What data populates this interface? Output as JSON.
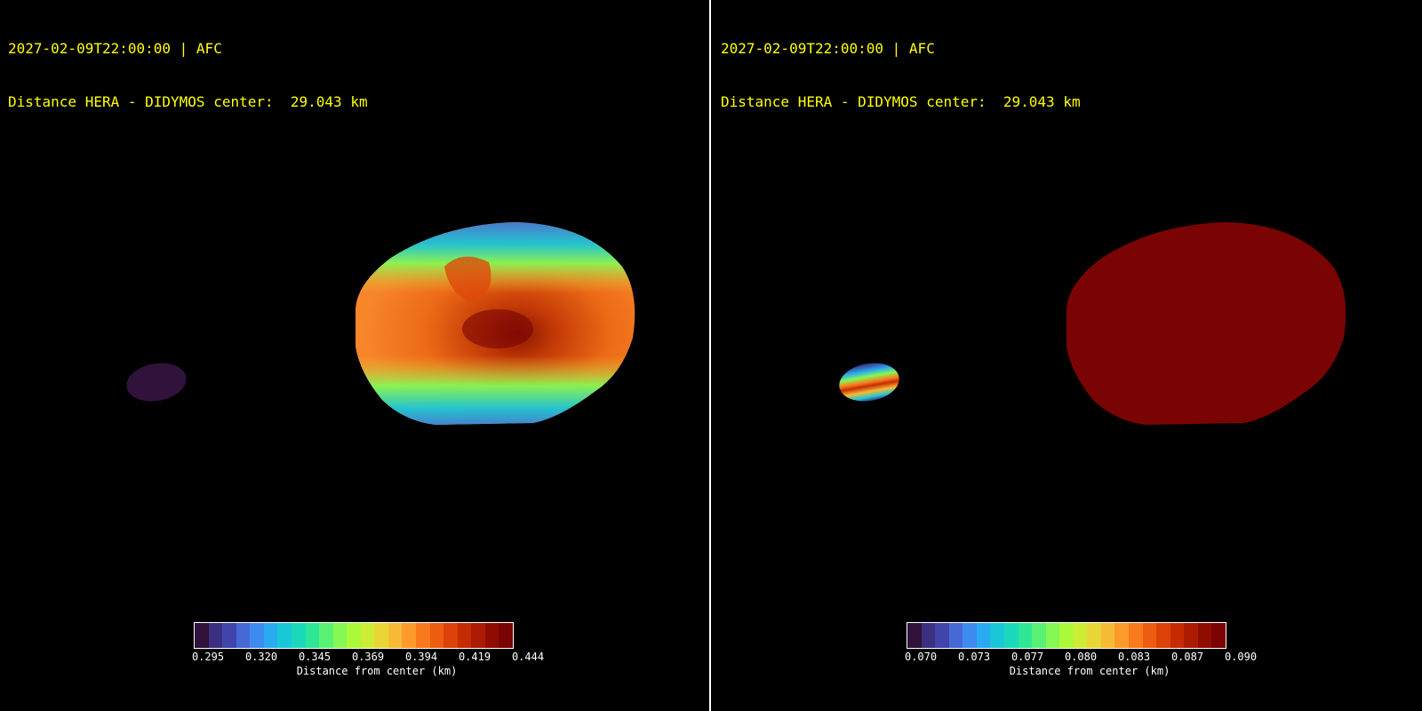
{
  "left_panel": {
    "header_line1": "2027-02-09T22:00:00 | AFC",
    "header_line2": "Distance HERA - DIDYMOS center:  29.043 km",
    "colorbar": {
      "ticks": [
        "0.295",
        "0.320",
        "0.345",
        "0.369",
        "0.394",
        "0.419",
        "0.444"
      ],
      "label": "Distance from center (km)"
    }
  },
  "right_panel": {
    "header_line1": "2027-02-09T22:00:00 | AFC",
    "header_line2": "Distance HERA - DIDYMOS center:  29.043 km",
    "colorbar": {
      "ticks": [
        "0.070",
        "0.073",
        "0.077",
        "0.080",
        "0.083",
        "0.087",
        "0.090"
      ],
      "label": "Distance from center (km)"
    }
  },
  "colormap": [
    "#30123b",
    "#3b2f80",
    "#4145ab",
    "#4669d5",
    "#3e8bf0",
    "#2aabf1",
    "#1ac7d8",
    "#1bd8bb",
    "#2ee696",
    "#58f174",
    "#85f853",
    "#aafa3a",
    "#cdec34",
    "#e8d636",
    "#f7ba36",
    "#fd9a2b",
    "#f97a1c",
    "#ee5c10",
    "#dd4208",
    "#c62c04",
    "#ad1a02",
    "#8f0c01",
    "#7a0403"
  ]
}
